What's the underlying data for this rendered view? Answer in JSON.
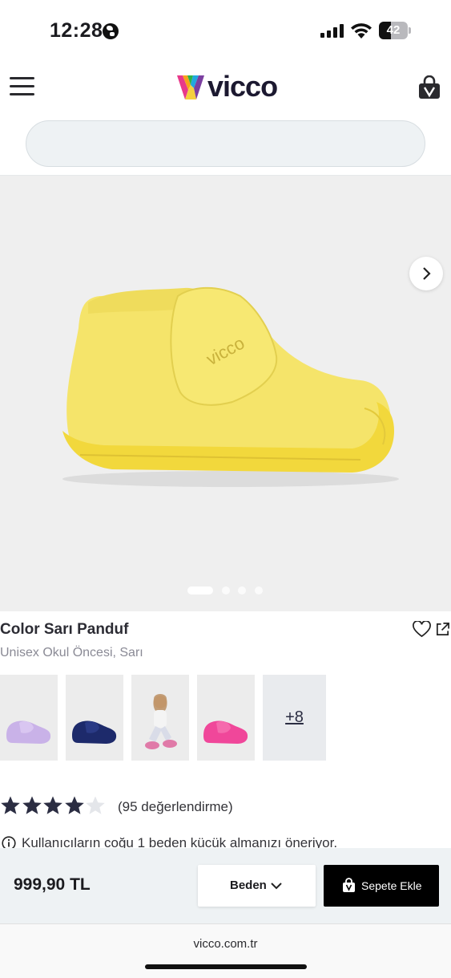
{
  "status_bar": {
    "time": "12:28",
    "battery_level": "42",
    "battery_fraction": 0.42
  },
  "header": {
    "logo_text": "vicco",
    "icons": [
      "menu-icon",
      "cart-icon"
    ]
  },
  "search": {
    "placeholder": ""
  },
  "gallery": {
    "image_count": 4,
    "active_index": 0,
    "next_icon": "chevron-right-icon"
  },
  "product": {
    "title": "Color Sarı Panduf",
    "subtitle": "Unisex Okul Öncesi, Sarı",
    "favorite_icon": "heart-icon",
    "share_icon": "share-icon"
  },
  "variants": {
    "items": [
      {
        "color": "#c9b2e8"
      },
      {
        "color": "#1d2a6b"
      },
      {
        "color": "#e07aa8"
      },
      {
        "color": "#f0479a"
      }
    ],
    "more_label": "+8"
  },
  "rating": {
    "stars": 4,
    "max": 5,
    "count_label": "(95 değerlendirme)"
  },
  "info": {
    "text": "Kullanıcıların coğu 1 beden kücük almanızı öneriyor.",
    "icon": "info-icon"
  },
  "purchase": {
    "price": "999,90 TL",
    "size_label": "Beden",
    "add_to_cart_label": "Sepete Ekle"
  },
  "browser": {
    "url": "vicco.com.tr"
  },
  "colors": {
    "accent_black": "#000000",
    "product_yellow": "#f5e46a",
    "bar_bg": "#eef2f4"
  }
}
